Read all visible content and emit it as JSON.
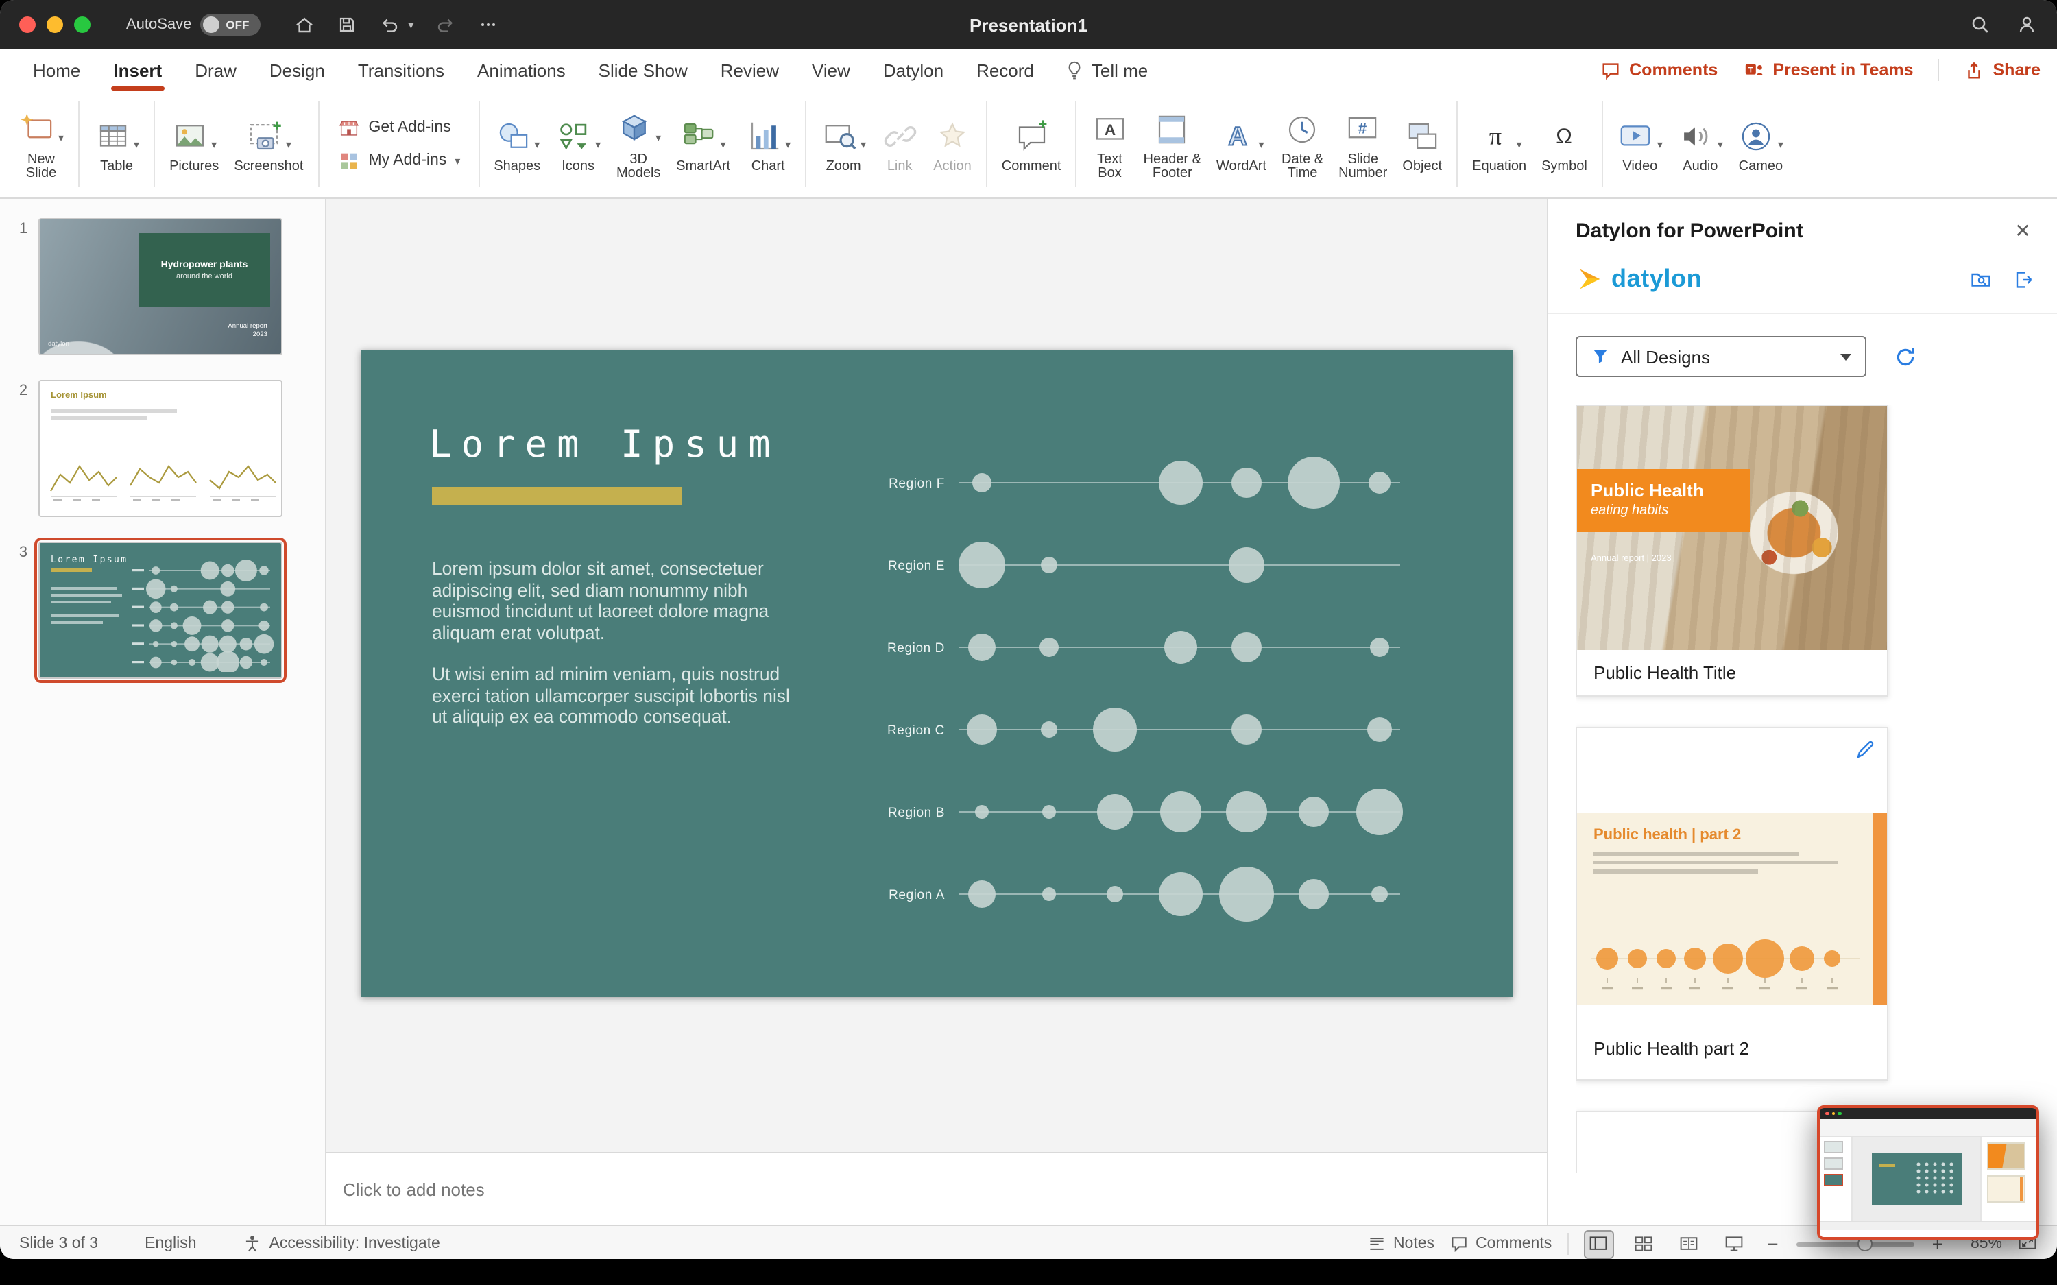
{
  "window": {
    "title": "Presentation1"
  },
  "titlebar": {
    "autosave": "AutoSave",
    "autosave_state": "OFF"
  },
  "tabs": [
    {
      "label": "Home"
    },
    {
      "label": "Insert",
      "active": true
    },
    {
      "label": "Draw"
    },
    {
      "label": "Design"
    },
    {
      "label": "Transitions"
    },
    {
      "label": "Animations"
    },
    {
      "label": "Slide Show"
    },
    {
      "label": "Review"
    },
    {
      "label": "View"
    },
    {
      "label": "Datylon"
    },
    {
      "label": "Record"
    }
  ],
  "tell_me": "Tell me",
  "top_actions": {
    "comments": "Comments",
    "present_in_teams": "Present in Teams",
    "share": "Share"
  },
  "ribbon": {
    "get_addins": "Get Add-ins",
    "my_addins": "My Add-ins",
    "items": [
      {
        "id": "new-slide",
        "label": [
          "New",
          "Slide"
        ],
        "chevron": true
      },
      {
        "sep": true
      },
      {
        "id": "table",
        "label": [
          "Table"
        ],
        "chevron": true
      },
      {
        "sep": true
      },
      {
        "id": "pictures",
        "label": [
          "Pictures"
        ],
        "chevron": true
      },
      {
        "id": "screenshot",
        "label": [
          "Screenshot"
        ],
        "chevron": true
      },
      {
        "sep": true
      },
      {
        "addins": true
      },
      {
        "sep": true
      },
      {
        "id": "shapes",
        "label": [
          "Shapes"
        ],
        "chevron": true
      },
      {
        "id": "icons",
        "label": [
          "Icons"
        ],
        "chevron": true
      },
      {
        "id": "models-3d",
        "label": [
          "3D",
          "Models"
        ],
        "chevron": true
      },
      {
        "id": "smartart",
        "label": [
          "SmartArt"
        ],
        "chevron": true
      },
      {
        "id": "chart",
        "label": [
          "Chart"
        ],
        "chevron": true
      },
      {
        "sep": true
      },
      {
        "id": "zoom",
        "label": [
          "Zoom"
        ],
        "chevron": true
      },
      {
        "id": "link",
        "label": [
          "Link"
        ],
        "disabled": true
      },
      {
        "id": "action",
        "label": [
          "Action"
        ],
        "disabled": true
      },
      {
        "sep": true
      },
      {
        "id": "comment",
        "label": [
          "Comment"
        ]
      },
      {
        "sep": true
      },
      {
        "id": "text-box",
        "label": [
          "Text",
          "Box"
        ]
      },
      {
        "id": "header-footer",
        "label": [
          "Header &",
          "Footer"
        ]
      },
      {
        "id": "wordart",
        "label": [
          "WordArt"
        ],
        "chevron": true
      },
      {
        "id": "date-time",
        "label": [
          "Date &",
          "Time"
        ]
      },
      {
        "id": "slide-number",
        "label": [
          "Slide",
          "Number"
        ]
      },
      {
        "id": "object",
        "label": [
          "Object"
        ]
      },
      {
        "sep": true
      },
      {
        "id": "equation",
        "label": [
          "Equation"
        ],
        "chevron": true
      },
      {
        "id": "symbol",
        "label": [
          "Symbol"
        ]
      },
      {
        "sep": true
      },
      {
        "id": "video",
        "label": [
          "Video"
        ],
        "chevron": true
      },
      {
        "id": "audio",
        "label": [
          "Audio"
        ],
        "chevron": true
      },
      {
        "id": "cameo",
        "label": [
          "Cameo"
        ],
        "chevron": true
      }
    ]
  },
  "slides_panel": {
    "slides": [
      {
        "num": "1",
        "thumb_title": "Hydropower plants",
        "thumb_subtitle": "around the world",
        "thumb_note1": "Annual report",
        "thumb_note2": "2023",
        "brand": "datylon"
      },
      {
        "num": "2",
        "thumb_title": "Lorem Ipsum"
      },
      {
        "num": "3",
        "thumb_title": "Lorem Ipsum",
        "selected": true
      }
    ]
  },
  "slide": {
    "title": "Lorem Ipsum",
    "para1": "Lorem ipsum dolor sit amet, consectetuer adipiscing elit, sed diam nonummy nibh euismod tincidunt ut laoreet dolore magna aliquam erat volutpat.",
    "para2": "Ut wisi enim ad minim veniam, quis nostrud exerci tation ullamcorper suscipit lobortis nisl ut aliquip ex ea commodo consequat.",
    "chart": {
      "type": "bubble",
      "bubble_color": "#c6d5d2",
      "rows": [
        {
          "label": "Region F",
          "bubbles": [
            [
              453,
              7
            ],
            [
              598,
              16
            ],
            [
              646,
              11
            ],
            [
              695,
              19
            ],
            [
              743,
              8
            ]
          ]
        },
        {
          "label": "Region E",
          "bubbles": [
            [
              453,
              17
            ],
            [
              502,
              6
            ],
            [
              646,
              13
            ]
          ]
        },
        {
          "label": "Region D",
          "bubbles": [
            [
              453,
              10
            ],
            [
              502,
              7
            ],
            [
              598,
              12
            ],
            [
              646,
              11
            ],
            [
              743,
              7
            ]
          ]
        },
        {
          "label": "Region C",
          "bubbles": [
            [
              453,
              11
            ],
            [
              502,
              6
            ],
            [
              550,
              16
            ],
            [
              646,
              11
            ],
            [
              743,
              9
            ]
          ]
        },
        {
          "label": "Region B",
          "bubbles": [
            [
              453,
              5
            ],
            [
              502,
              5
            ],
            [
              550,
              13
            ],
            [
              598,
              15
            ],
            [
              646,
              15
            ],
            [
              695,
              11
            ],
            [
              743,
              17
            ]
          ]
        },
        {
          "label": "Region A",
          "bubbles": [
            [
              453,
              10
            ],
            [
              502,
              5
            ],
            [
              550,
              6
            ],
            [
              598,
              16
            ],
            [
              646,
              20
            ],
            [
              695,
              11
            ],
            [
              743,
              6
            ]
          ]
        }
      ]
    }
  },
  "notes": {
    "placeholder": "Click to add notes"
  },
  "statusbar": {
    "slide_info": "Slide 3 of 3",
    "language": "English",
    "accessibility": "Accessibility: Investigate",
    "notes": "Notes",
    "comments": "Comments",
    "zoom": "85%"
  },
  "panel": {
    "title": "Datylon for PowerPoint",
    "brand": "datylon",
    "filter_value": "All Designs",
    "accent": "#f28a1e",
    "cards": [
      {
        "overlay_title": "Public Health",
        "overlay_subtitle": "eating habits",
        "overlay_note": "Annual report | 2023",
        "caption": "Public Health Title"
      },
      {
        "chart_title": "Public health | part 2",
        "caption": "Public Health part 2",
        "bubbles": [
          [
            16,
            8
          ],
          [
            38,
            7
          ],
          [
            59,
            7
          ],
          [
            80,
            8
          ],
          [
            104,
            11
          ],
          [
            131,
            14
          ],
          [
            158,
            9
          ],
          [
            180,
            6
          ]
        ]
      }
    ]
  }
}
